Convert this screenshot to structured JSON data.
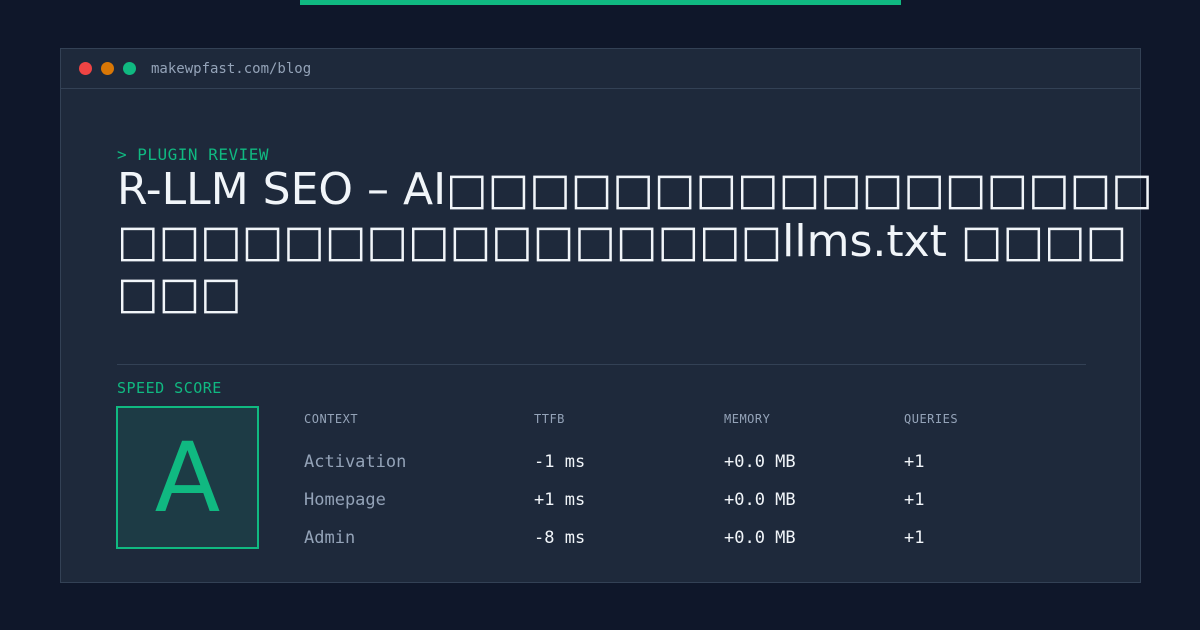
{
  "colors": {
    "background": "#0f172a",
    "panel": "#1e293b",
    "accent": "#10b981",
    "border": "#334155",
    "muted_text": "#94a3b8",
    "text": "#f1f5f9"
  },
  "window": {
    "url": "makewpfast.com/blog",
    "controls": [
      "close-dot",
      "minimize-dot",
      "maximize-dot"
    ]
  },
  "article": {
    "kicker": "> PLUGIN REVIEW",
    "title": "R-LLM SEO – AI□□□□□□□□□□□□□□□□□□□□□□□□□□□□□□□□□llms.txt □□□□□□□"
  },
  "speed": {
    "label": "SPEED SCORE",
    "grade": "A"
  },
  "metrics": {
    "headers": [
      "CONTEXT",
      "TTFB",
      "MEMORY",
      "QUERIES"
    ],
    "rows": [
      [
        "Activation",
        "-1 ms",
        "+0.0 MB",
        "+1"
      ],
      [
        "Homepage",
        "+1 ms",
        "+0.0 MB",
        "+1"
      ],
      [
        "Admin",
        "-8 ms",
        "+0.0 MB",
        "+1"
      ]
    ]
  }
}
